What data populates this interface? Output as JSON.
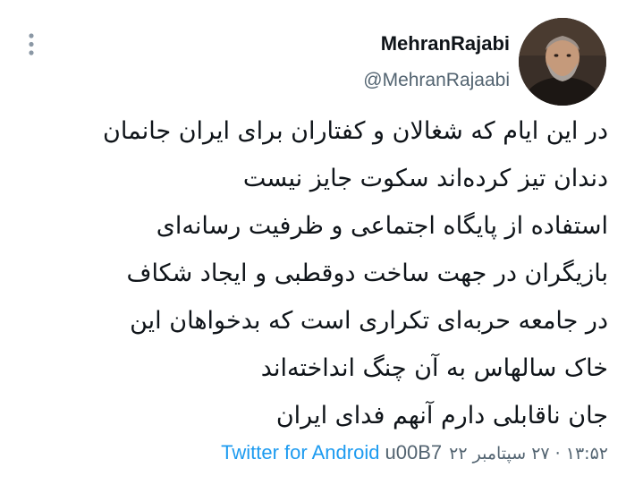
{
  "author": {
    "display_name": "MehranRajabi",
    "handle": "@MehranRajaabi"
  },
  "tweet": {
    "lines": [
      "در این ایام که شغالان و کفتاران برای ایران جانمان",
      "دندان تیز کرده‌اند سکوت جایز نیست",
      "استفاده از پایگاه اجتماعی و ظرفیت رسانه‌ای",
      "بازیگران در جهت ساخت دوقطبی و ایجاد شکاف",
      "در جامعه حربه‌ای تکراری است که بدخواهان این",
      "خاک سالهاس به آن چنگ انداخته‌اند",
      "جان ناقابلی دارم آنهم فدای ایران"
    ]
  },
  "meta": {
    "timestamp": "۱۳:۵۲ · ۲۷ سپتامبر ۲۲",
    "source": "Twitter for Android",
    "escape_text": "u00B7"
  },
  "icons": {
    "more": "more-vertical-icon",
    "avatar": "profile-photo"
  },
  "colors": {
    "link": "#1d9bf0",
    "secondary_text": "#536471",
    "primary_text": "#0f1419"
  }
}
